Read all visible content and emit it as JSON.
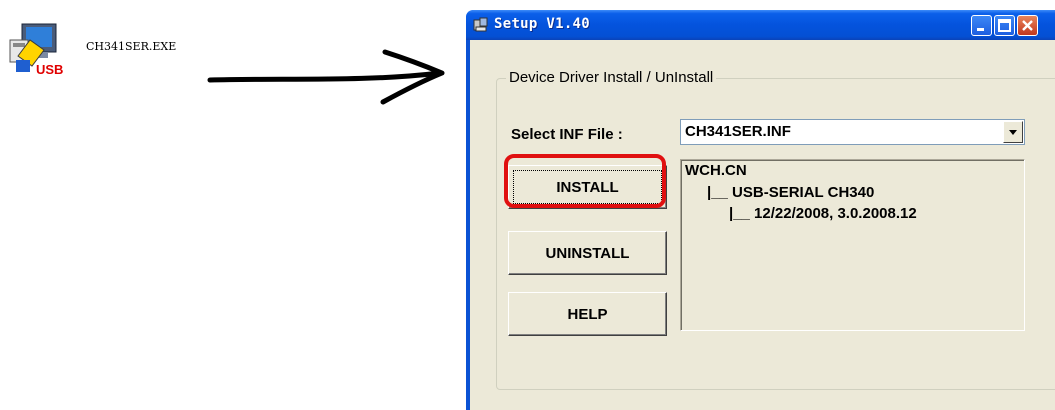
{
  "desktop": {
    "icon_name": "usb-setup-exe-icon",
    "icon_badge": "USB",
    "file_label": "CH341SER.EXE"
  },
  "window": {
    "title": "Setup V1.40",
    "group_label": "Device Driver Install / UnInstall",
    "select_label": "Select INF File :",
    "select_value": "CH341SER.INF",
    "buttons": {
      "install": "INSTALL",
      "uninstall": "UNINSTALL",
      "help": "HELP"
    },
    "info_lines": [
      "WCH.CN",
      "|__ USB-SERIAL CH340",
      "|__ 12/22/2008, 3.0.2008.12"
    ]
  },
  "colors": {
    "highlight": "#e01010",
    "titlebar": "#0453dd",
    "dialog_bg": "#ece9d8"
  }
}
